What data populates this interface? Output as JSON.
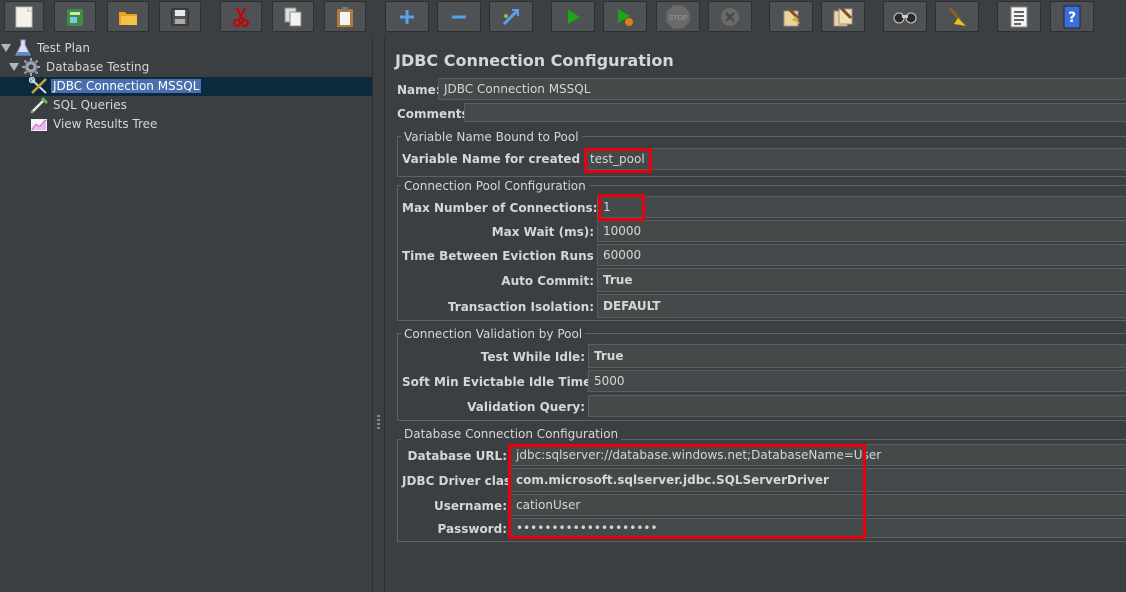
{
  "toolbar": {
    "buttons": [
      {
        "name": "new-icon"
      },
      {
        "name": "templates-icon"
      },
      {
        "name": "open-icon"
      },
      {
        "name": "save-icon"
      },
      {
        "name": "cut-icon"
      },
      {
        "name": "copy-icon"
      },
      {
        "name": "paste-icon"
      },
      {
        "name": "expand-icon"
      },
      {
        "name": "collapse-icon"
      },
      {
        "name": "toggle-icon"
      },
      {
        "name": "start-icon"
      },
      {
        "name": "start-no-pauses-icon"
      },
      {
        "name": "stop-icon"
      },
      {
        "name": "shutdown-icon"
      },
      {
        "name": "clear-icon"
      },
      {
        "name": "clear-all-icon"
      },
      {
        "name": "search-icon"
      },
      {
        "name": "reset-search-icon"
      },
      {
        "name": "function-helper-icon"
      },
      {
        "name": "help-icon"
      }
    ],
    "stop_label": "STOP"
  },
  "tree": {
    "items": [
      {
        "label": "Test Plan"
      },
      {
        "label": "Database Testing"
      },
      {
        "label": "JDBC Connection MSSQL"
      },
      {
        "label": "SQL Queries"
      },
      {
        "label": "View Results Tree"
      }
    ]
  },
  "panel": {
    "title": "JDBC Connection Configuration",
    "name_label": "Name:",
    "name_value": "JDBC Connection MSSQL",
    "comments_label": "Comments:",
    "pool_group": {
      "title": "Variable Name Bound to Pool",
      "var_label": "Variable Name for created pool:",
      "var_value": "test_pool"
    },
    "conn_pool_group": {
      "title": "Connection Pool Configuration",
      "max_conn_label": "Max Number of Connections:",
      "max_conn_value": "1",
      "max_wait_label": "Max Wait (ms):",
      "max_wait_value": "10000",
      "eviction_label": "Time Between Eviction Runs (ms):",
      "eviction_value": "60000",
      "auto_commit_label": "Auto Commit:",
      "auto_commit_value": "True",
      "isolation_label": "Transaction Isolation:",
      "isolation_value": "DEFAULT"
    },
    "validation_group": {
      "title": "Connection Validation by Pool",
      "test_idle_label": "Test While Idle:",
      "test_idle_value": "True",
      "soft_min_label": "Soft Min Evictable Idle Time(ms):",
      "soft_min_value": "5000",
      "query_label": "Validation Query:",
      "query_value": ""
    },
    "db_group": {
      "title": "Database Connection Configuration",
      "url_label": "Database URL:",
      "url_value": "jdbc:sqlserver://database.windows.net;DatabaseName=User",
      "driver_label": "JDBC Driver class:",
      "driver_value": "com.microsoft.sqlserver.jdbc.SQLServerDriver",
      "username_label": "Username:",
      "username_value": "cationUser",
      "password_label": "Password:",
      "password_value": "••••••••••••••••••••"
    }
  },
  "colors": {
    "background": "#3c3f41",
    "field_bg": "#45494a",
    "selection": "#4b6eaf",
    "highlight": "#e8000b"
  }
}
